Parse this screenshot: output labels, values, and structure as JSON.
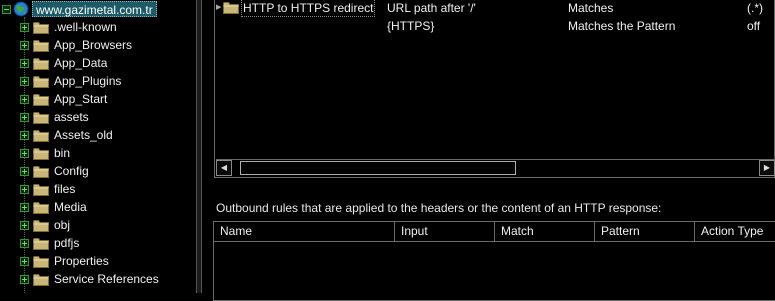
{
  "tree": {
    "root_label": "www.gazimetal.com.tr",
    "root_icon": "globe-icon",
    "items": [
      {
        "label": ".well-known",
        "icon": "folder-icon"
      },
      {
        "label": "App_Browsers",
        "icon": "folder-icon"
      },
      {
        "label": "App_Data",
        "icon": "folder-icon"
      },
      {
        "label": "App_Plugins",
        "icon": "folder-icon"
      },
      {
        "label": "App_Start",
        "icon": "folder-icon"
      },
      {
        "label": "assets",
        "icon": "folder-icon"
      },
      {
        "label": "Assets_old",
        "icon": "folder-icon"
      },
      {
        "label": "bin",
        "icon": "folder-icon"
      },
      {
        "label": "Config",
        "icon": "folder-icon"
      },
      {
        "label": "files",
        "icon": "folder-icon"
      },
      {
        "label": "Media",
        "icon": "folder-icon"
      },
      {
        "label": "obj",
        "icon": "folder-icon"
      },
      {
        "label": "pdfjs",
        "icon": "folder-icon"
      },
      {
        "label": "Properties",
        "icon": "folder-icon"
      },
      {
        "label": "Service References",
        "icon": "folder-icon"
      }
    ]
  },
  "inbound": {
    "rows": [
      {
        "name": "HTTP to HTTPS redirect",
        "input": "URL path after '/'",
        "match": "Matches",
        "pattern": "(.*)"
      },
      {
        "name": "",
        "input": "{HTTPS}",
        "match": "Matches the Pattern",
        "pattern": "off"
      }
    ]
  },
  "outbound": {
    "caption": "Outbound rules that are applied to the headers or the content of an HTTP response:",
    "columns": [
      "Name",
      "Input",
      "Match",
      "Pattern",
      "Action Type"
    ]
  },
  "colors": {
    "background": "#000000",
    "selection": "#1c5a66",
    "text": "#f0f0f0"
  }
}
